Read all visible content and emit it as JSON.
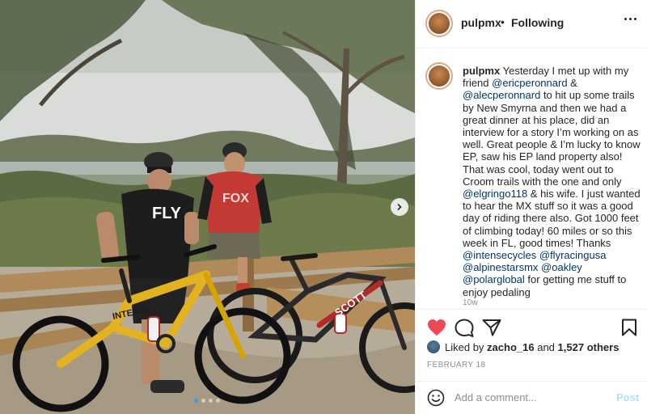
{
  "post": {
    "username": "pulpmx",
    "follow_separator": "•",
    "follow_status": "Following",
    "caption": [
      {
        "t": "u",
        "v": "pulpmx"
      },
      {
        "t": "s",
        "v": " Yesterday I met up with my friend "
      },
      {
        "t": "m",
        "v": "@ericperonnard"
      },
      {
        "t": "s",
        "v": " & "
      },
      {
        "t": "m",
        "v": "@alecperonnard"
      },
      {
        "t": "s",
        "v": " to hit up some trails by New Smyrna and then we had a great dinner at his place, did an interview for a story I’m working on as well. Great people & I’m lucky to know EP, saw his EP land property also! That was cool, today went out to Croom trails with the one and only "
      },
      {
        "t": "m",
        "v": "@elgringo118"
      },
      {
        "t": "s",
        "v": " & his wife. I just wanted to hear the MX stuff so it was a good day of riding there also. Got 1000 feet of climbing today! 60 miles or so this week in FL, good times! Thanks "
      },
      {
        "t": "m",
        "v": "@intensecycles"
      },
      {
        "t": "s",
        "v": " "
      },
      {
        "t": "m",
        "v": "@flyracingusa"
      },
      {
        "t": "s",
        "v": " "
      },
      {
        "t": "m",
        "v": "@alpinestarsmx"
      },
      {
        "t": "s",
        "v": " "
      },
      {
        "t": "m",
        "v": "@oakley"
      },
      {
        "t": "s",
        "v": " "
      },
      {
        "t": "m",
        "v": "@polarglobal"
      },
      {
        "t": "s",
        "v": " for getting me stuff to enjoy pedaling"
      }
    ],
    "age": "10w",
    "liked_by_prefix": "Liked by ",
    "liked_by_user": "zacho_16",
    "liked_by_and": " and ",
    "liked_by_count": "1,527 others",
    "date": "FEBRUARY 18",
    "comment_placeholder": "Add a comment...",
    "post_button": "Post",
    "photo": {
      "shirt_left_text": "FLY",
      "shirt_right_text": "FOX",
      "bike_left_brand": "INTENSE",
      "bike_right_brand": "SCOTT"
    },
    "carousel": {
      "total": 4,
      "active": 1
    },
    "colors": {
      "link": "#00376b",
      "heart": "#ed4956",
      "post_disabled": "#b2dffc",
      "carousel_active": "#3897f0"
    },
    "icons": [
      "more-options-icon",
      "heart-icon",
      "comment-icon",
      "share-icon",
      "bookmark-icon",
      "emoji-icon",
      "chevron-right-icon"
    ]
  }
}
